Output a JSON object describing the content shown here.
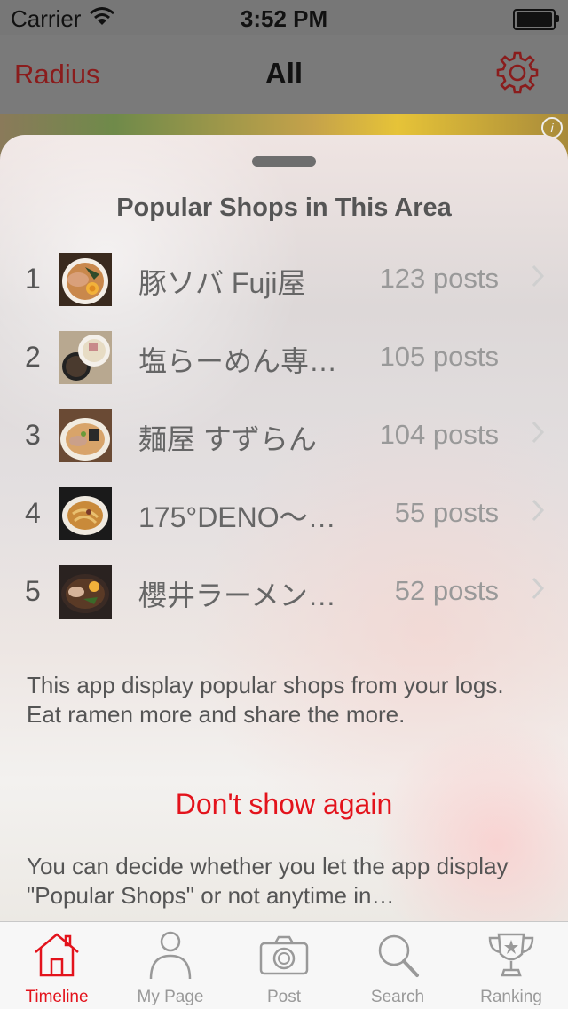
{
  "status_bar": {
    "carrier": "Carrier",
    "time": "3:52 PM"
  },
  "nav": {
    "left": "Radius",
    "title": "All"
  },
  "sheet": {
    "title": "Popular Shops in This Area",
    "shops": [
      {
        "rank": "1",
        "name": "豚ソバ Fuji屋",
        "posts": "123 posts"
      },
      {
        "rank": "2",
        "name": "塩らーめん専…",
        "posts": "105 posts"
      },
      {
        "rank": "3",
        "name": "麺屋 すずらん",
        "posts": "104 posts"
      },
      {
        "rank": "4",
        "name": "175°DENO〜…",
        "posts": "55 posts"
      },
      {
        "rank": "5",
        "name": "櫻井ラーメン…",
        "posts": "52 posts"
      }
    ],
    "description": "This app display popular shops from your logs. Eat ramen more and share the more.",
    "dont_show": "Don't show again",
    "note": "You can decide whether you let the app display \"Popular Shops\" or not anytime in…"
  },
  "tabs": [
    {
      "label": "Timeline",
      "icon": "home-icon",
      "active": true
    },
    {
      "label": "My Page",
      "icon": "person-icon"
    },
    {
      "label": "Post",
      "icon": "camera-icon"
    },
    {
      "label": "Search",
      "icon": "search-icon"
    },
    {
      "label": "Ranking",
      "icon": "trophy-icon"
    }
  ],
  "colors": {
    "accent": "#e3131c",
    "nav_accent": "#8a1c1c"
  }
}
